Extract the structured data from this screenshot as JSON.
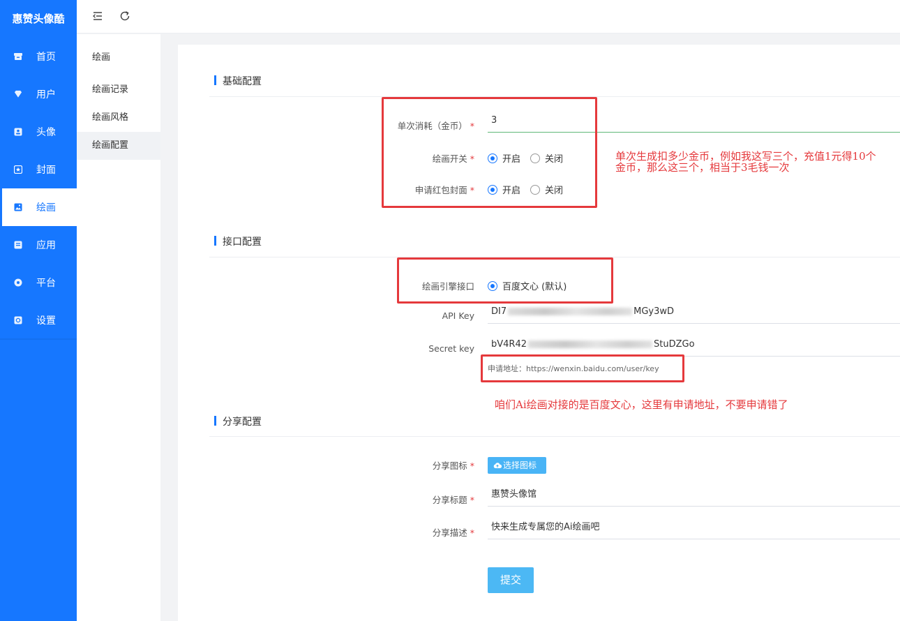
{
  "brand": "惠赞头像酷",
  "nav": {
    "items": [
      {
        "label": "首页",
        "icon": "archive-icon"
      },
      {
        "label": "用户",
        "icon": "heart-icon"
      },
      {
        "label": "头像",
        "icon": "user-card-icon"
      },
      {
        "label": "封面",
        "icon": "star-icon"
      },
      {
        "label": "绘画",
        "icon": "image-icon",
        "active": true
      },
      {
        "label": "应用",
        "icon": "app-icon"
      },
      {
        "label": "平台",
        "icon": "circle-icon"
      },
      {
        "label": "设置",
        "icon": "gear-icon"
      }
    ]
  },
  "topbar": {
    "collapse_icon": "menu-collapse-icon",
    "refresh_icon": "refresh-icon"
  },
  "subnav": {
    "title": "绘画",
    "items": [
      {
        "label": "绘画记录"
      },
      {
        "label": "绘画风格"
      },
      {
        "label": "绘画配置",
        "active": true
      }
    ]
  },
  "basic": {
    "title": "基础配置",
    "cost_label": "单次消耗（金币）",
    "cost_value": "3",
    "switch_label": "绘画开关",
    "redpack_label": "申请红包封面",
    "on": "开启",
    "off": "关闭"
  },
  "api": {
    "title": "接口配置",
    "engine_label": "绘画引擎接口",
    "engine_option": "百度文心 (默认)",
    "api_key_label": "API Key",
    "api_key_start": "DI7",
    "api_key_end": "MGy3wD",
    "secret_label": "Secret key",
    "secret_start": "bV4R42",
    "secret_end": "StuDZGo",
    "hint": "申请地址：https://wenxin.baidu.com/user/key"
  },
  "share": {
    "title": "分享配置",
    "icon_label": "分享图标",
    "icon_button": "选择图标",
    "title_label": "分享标题",
    "title_value": "惠赞头像馆",
    "desc_label": "分享描述",
    "desc_value": "快来生成专属您的Ai绘画吧",
    "submit": "提交"
  },
  "notes": {
    "note1_line1": "单次生成扣多少金币，例如我这写三个，充值1元得10个",
    "note1_line2": "金币，那么这三个，相当于3毛钱一次",
    "note2": "咱们Ai绘画对接的是百度文心，这里有申请地址，不要申请错了"
  },
  "colors": {
    "primary": "#1677ff",
    "annotation": "#e5393c",
    "button": "#4cb8f4"
  }
}
